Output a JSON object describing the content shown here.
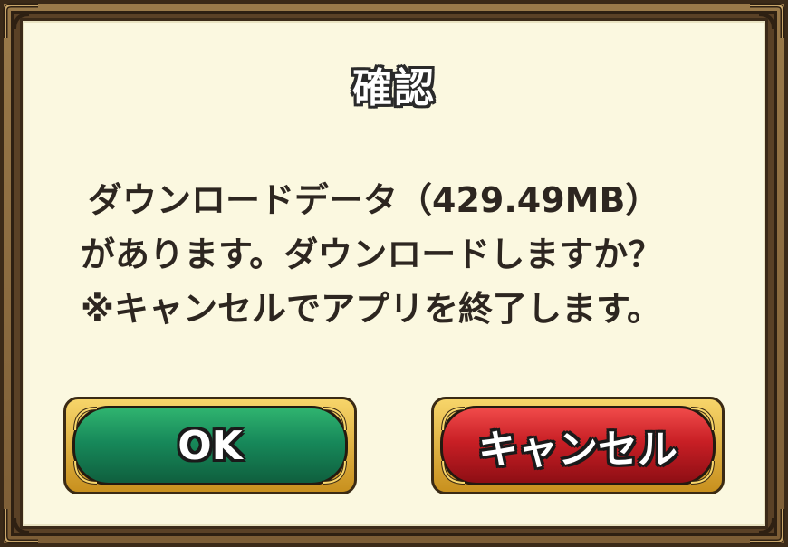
{
  "dialog": {
    "title": "確認",
    "message_lines": [
      "ダウンロードデータ（429.49MB）",
      "があります。ダウンロードしますか？",
      "※キャンセルでアプリを終了します。"
    ],
    "ok_label": "OK",
    "cancel_label": "キャンセル"
  },
  "colors": {
    "panel_bg": "#fbf8e0",
    "ok_button": "#17895a",
    "cancel_button": "#c81f25",
    "button_trim": "#e6b43c",
    "frame": "#7d5e36"
  }
}
